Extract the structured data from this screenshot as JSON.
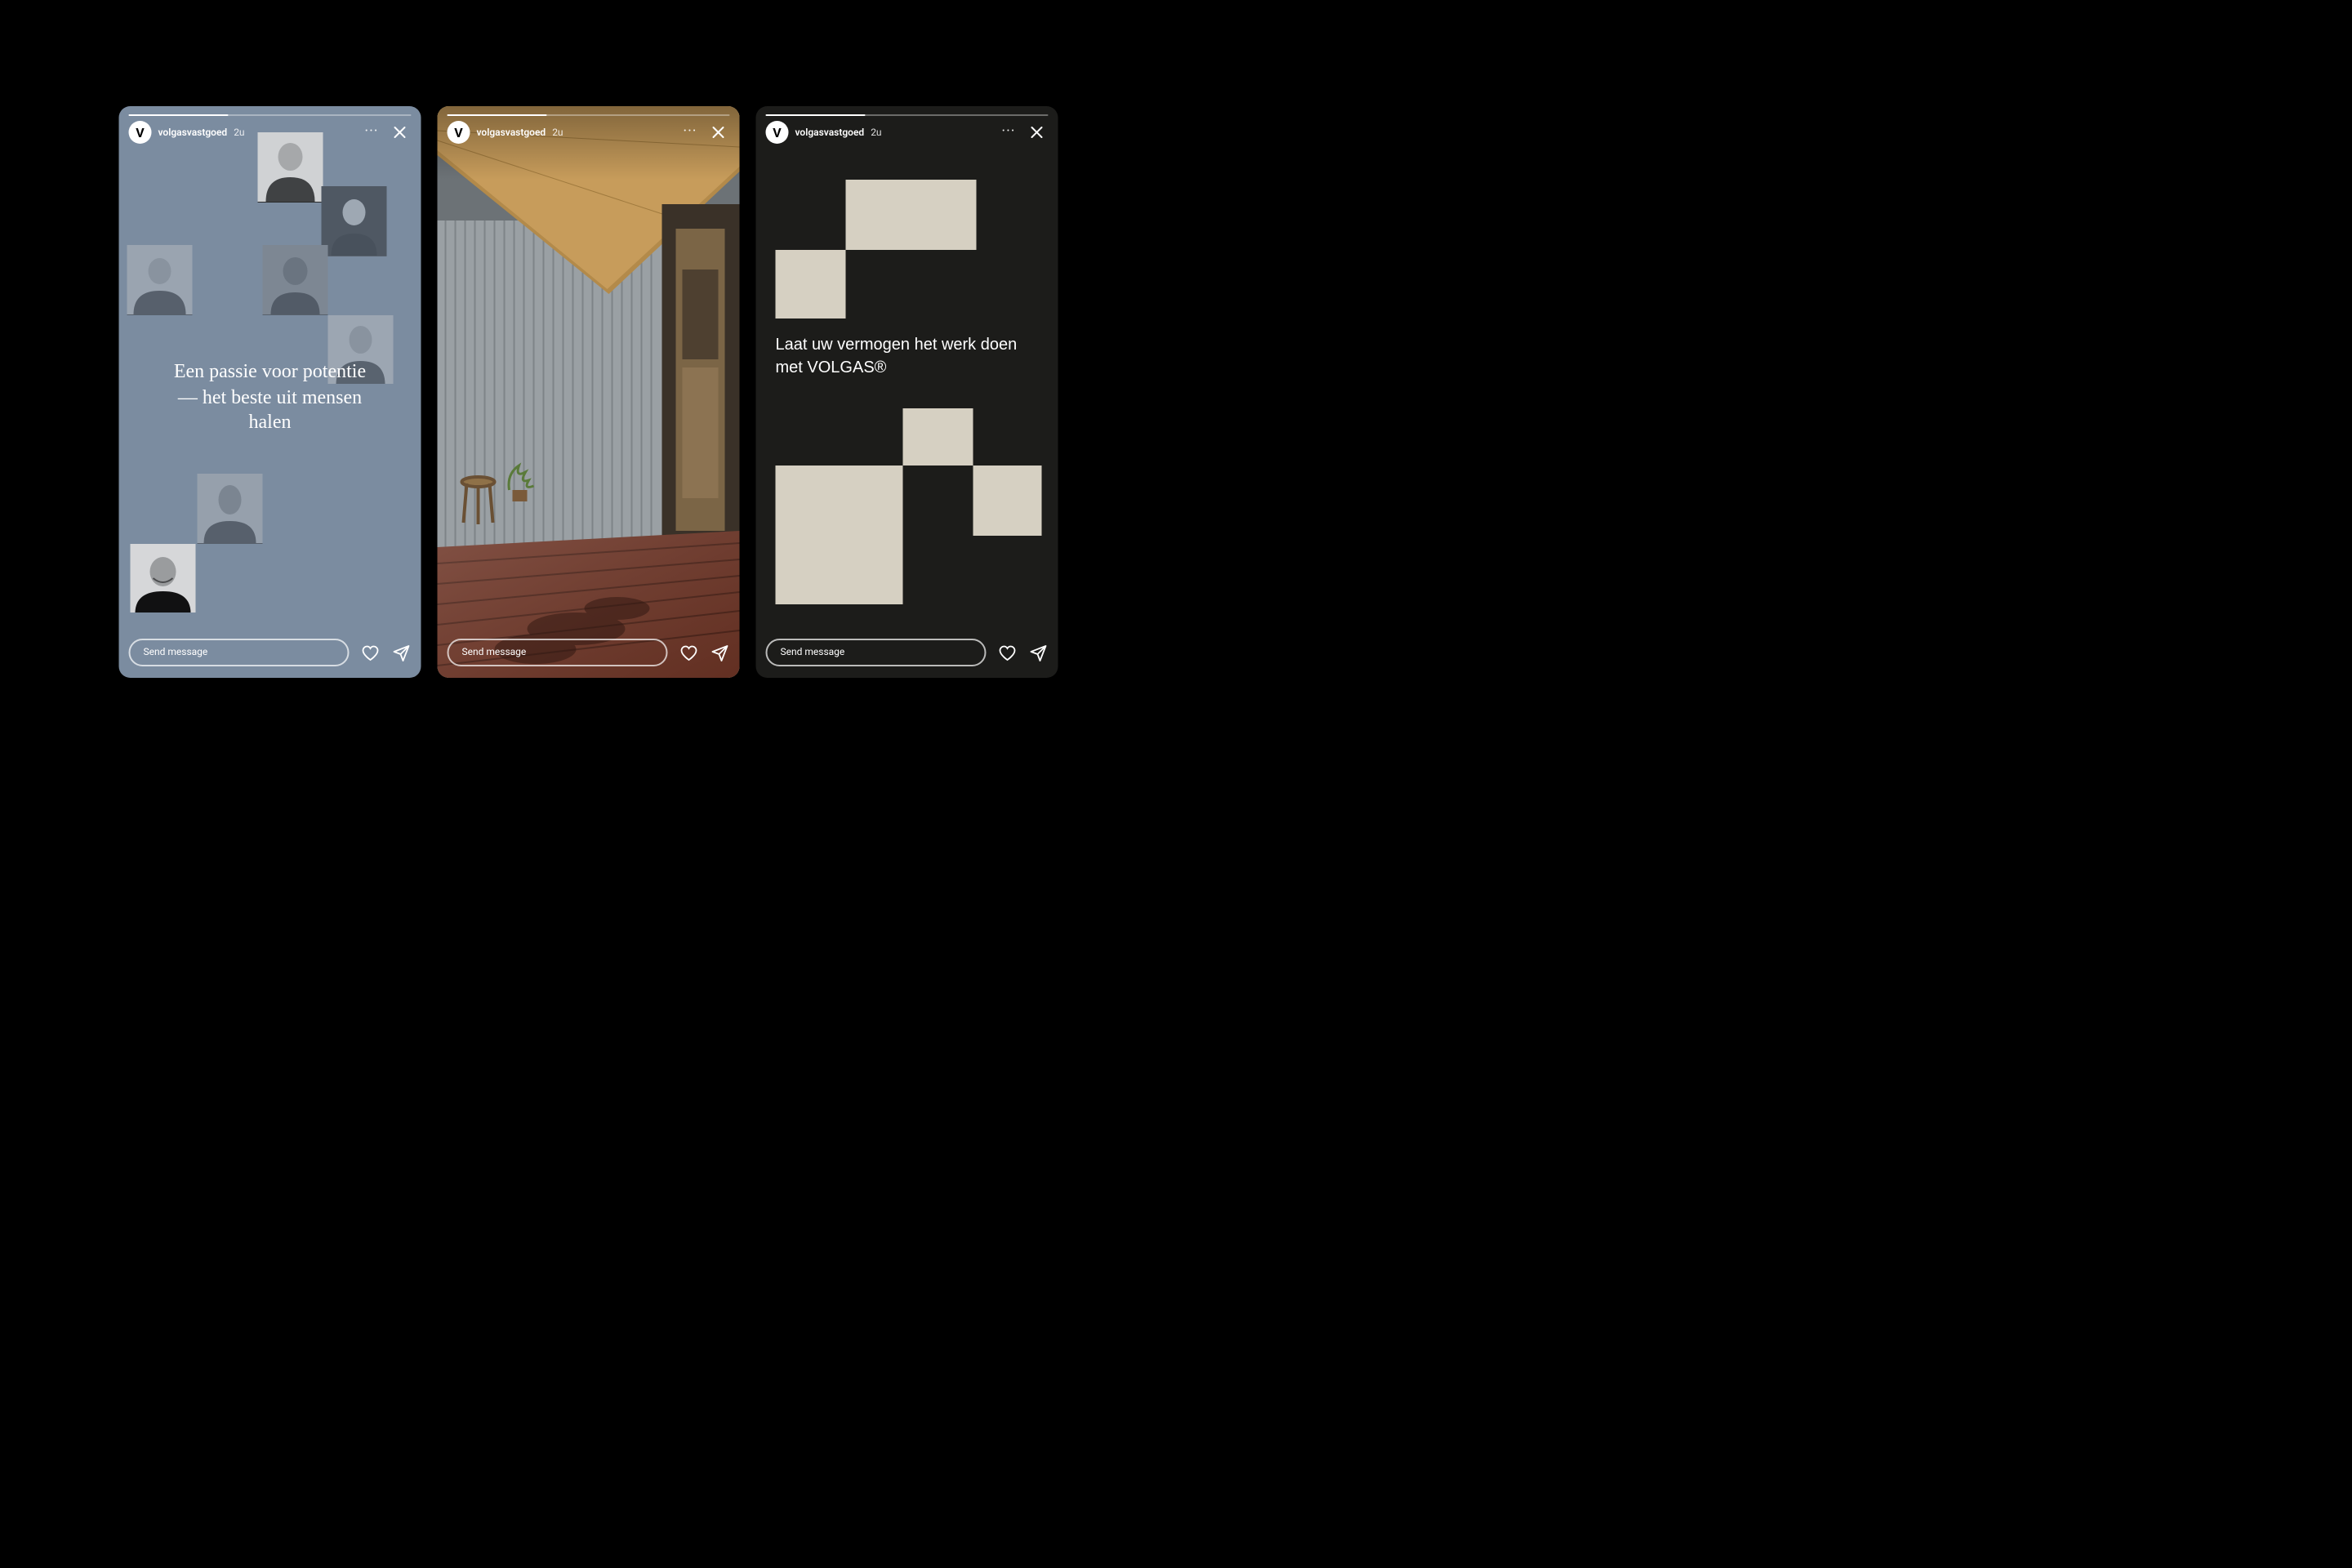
{
  "stories": [
    {
      "username": "volgasvastgoed",
      "time": "2u",
      "avatar_letter": "V",
      "message_placeholder": "Send message",
      "headline": "Een passie voor potentie — het beste uit mensen halen",
      "portrait_count": 7
    },
    {
      "username": "volgasvastgoed",
      "time": "2u",
      "avatar_letter": "V",
      "message_placeholder": "Send message"
    },
    {
      "username": "volgasvastgoed",
      "time": "2u",
      "avatar_letter": "V",
      "message_placeholder": "Send message",
      "headline": "Laat uw vermogen het werk doen met VOLGAS®"
    }
  ],
  "colors": {
    "story1_bg": "#7b8ca0",
    "story3_bg": "#1c1c1a",
    "block_fill": "#d6d0c2"
  }
}
